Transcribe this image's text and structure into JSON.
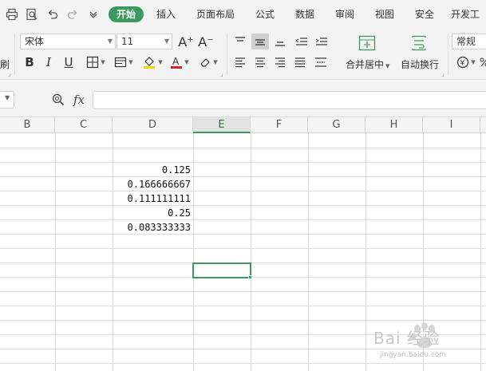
{
  "menu": {
    "tabs": [
      {
        "label": "开始",
        "active": true
      },
      {
        "label": "插入"
      },
      {
        "label": "页面布局"
      },
      {
        "label": "公式"
      },
      {
        "label": "数据"
      },
      {
        "label": "审阅"
      },
      {
        "label": "视图"
      },
      {
        "label": "安全"
      },
      {
        "label": "开发工"
      }
    ],
    "quick_access_icons": [
      "print-icon",
      "print-preview-icon",
      "undo-icon",
      "redo-icon",
      "customize-dropdown-icon"
    ]
  },
  "ribbon": {
    "font_name": "宋体",
    "font_size": "11",
    "increase_font": "A⁺",
    "decrease_font": "A⁻",
    "bold": "B",
    "italic": "I",
    "underline": "U",
    "merge_center_label": "合并居中",
    "wrap_text_label": "自动换行",
    "number_format": "常规",
    "paste_label_fragment": "刷"
  },
  "formula_bar": {
    "fx_label": "fx",
    "formula": ""
  },
  "sheet": {
    "columns": [
      "B",
      "C",
      "D",
      "E",
      "F",
      "G",
      "H",
      "I"
    ],
    "selected_column": "E",
    "cells_d": [
      "",
      "",
      "0.125",
      "0.166666667",
      "0.111111111",
      "0.25",
      "0.083333333"
    ]
  },
  "colors": {
    "accent": "#3c9a5f",
    "font_highlight": "#f5d400",
    "font_color": "#e02020"
  },
  "watermark": {
    "text": "Bai 经验",
    "url_text": "jingyan.baidu.com"
  }
}
